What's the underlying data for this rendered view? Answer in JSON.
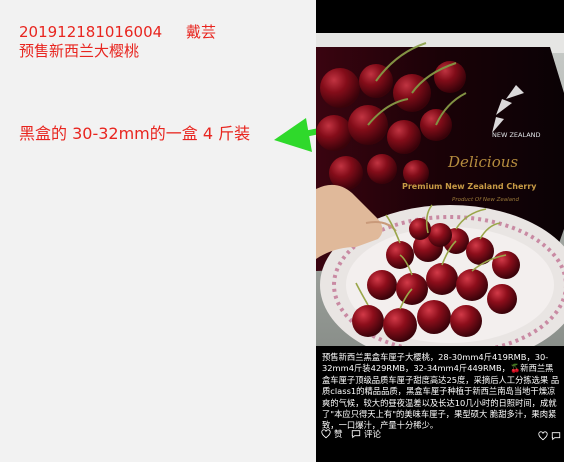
{
  "note": {
    "line1": "201912181016004     戴芸",
    "line2": "预售新西兰大樱桃",
    "arrow_text": "黑盒的 30-32mm的一盒 4 斤装"
  },
  "product_box": {
    "brand_line1": "NEW ZEALAND",
    "brand_line2": "Delicious",
    "subtitle": "Premium New Zealand Cherry",
    "origin": "Product Of New Zealand"
  },
  "post": {
    "caption": "预售新西兰黑盒车厘子大樱桃，28-30mm4斤419RMB，30-32mm4斤装429RMB，32-34mm4斤449RMB，🍒新西兰黑盒车厘子顶级品质车厘子甜度高达25度，采摘后人工分拣选果 品质class1的精品品质，黑盒车厘子种植于新西兰南岛当地干燥凉爽的气候，较大的昼夜温差以及长达10几小时的日照时间，成就了\"本应只得天上有\"的美味车厘子，果型硕大 脆甜多汁，果肉紧致，一口爆汁，产量十分稀少。",
    "like_label": "赞",
    "comment_label": "评论"
  },
  "colors": {
    "note_red": "#e8251f",
    "arrow_green": "#2fd92b"
  },
  "icons": [
    "heart-icon",
    "comment-icon",
    "arrow-left-icon"
  ]
}
